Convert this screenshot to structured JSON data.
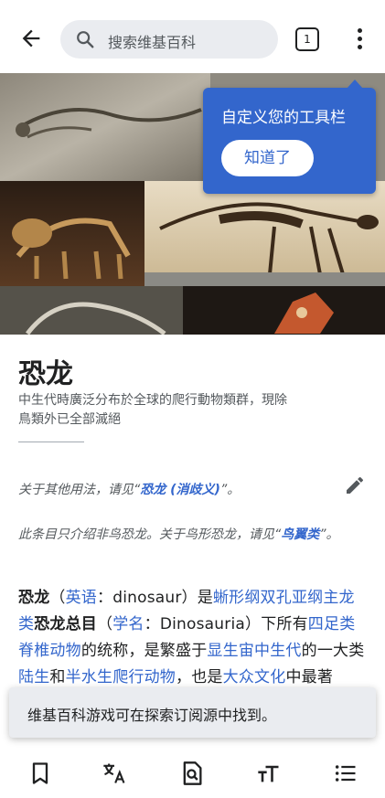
{
  "header": {
    "search_placeholder": "搜索维基百科",
    "tab_count": "1"
  },
  "tooltip": {
    "text": "自定义您的工具栏",
    "button_label": "知道了"
  },
  "article": {
    "title": "恐龙",
    "description_line1": "中生代時廣泛分布於全球的爬行動物類群，現除",
    "description_line2": "鳥類外已全部滅絕",
    "hatnote1": {
      "prefix": "关于其他用法，请见“",
      "link": "恐龙 (消歧义)",
      "suffix": "”。"
    },
    "hatnote2": {
      "prefix": "此条目只介绍非鸟恐龙。关于鸟形恐龙，请见“",
      "link": "鸟翼类",
      "suffix": "”。"
    },
    "lead": {
      "t1": "恐龙",
      "t2": "（",
      "l1": "英语",
      "t3": "：dinosaur）是",
      "l2": "蜥形纲双孔亚纲主龙类",
      "t4": "恐龙总目",
      "t5": "（",
      "l3": "学名",
      "t6": "：Dinosauria）下所有",
      "l4": "四足类脊椎动物",
      "t7": "的统称，是繁盛于",
      "l5": "显生宙中生代",
      "t8": "的一大类",
      "l6": "陆生",
      "t9": "和",
      "l7": "半水生爬行动物",
      "t10": "，也是",
      "l8": "大众文化",
      "t11": "中最著"
    }
  },
  "snackbar": {
    "text": "维基百科游戏可在探索订阅源中找到。"
  },
  "toolbar": {
    "icons": [
      "bookmark-icon",
      "translate-icon",
      "find-in-page-icon",
      "text-size-icon",
      "contents-icon"
    ]
  }
}
